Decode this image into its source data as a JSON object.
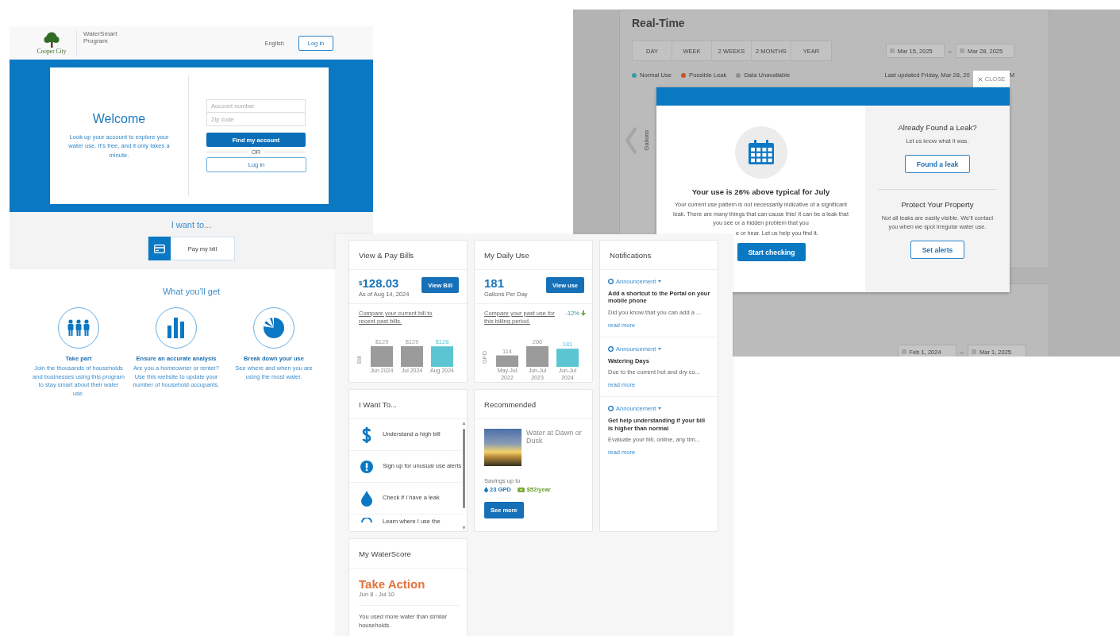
{
  "landing": {
    "logo_text": "Cooper City",
    "program_name": "WaterSmart Program",
    "language": "English",
    "login_button": "Log in",
    "welcome": {
      "title": "Welcome",
      "text": "Look up your account to explore your water use. It’s free, and it only takes a minute.",
      "account_field": {
        "placeholder": "Account number"
      },
      "zip_field": {
        "placeholder": "Zip code"
      },
      "find_button": "Find my account",
      "separator": "OR",
      "login_button": "Log in"
    },
    "i_want_to": {
      "title": "I want to...",
      "action": "Pay my bill"
    },
    "benefits": {
      "title": "What you’ll get",
      "items": [
        {
          "kind": "people",
          "title": "Take part",
          "text": "Join the thousands of households and businesses using this program to stay smart about their water use."
        },
        {
          "kind": "bars",
          "title": "Ensure an accurate analysis",
          "text": "Are you a homeowner or renter? Use this website to update your number of household occupants."
        },
        {
          "kind": "pie",
          "title": "Break down your use",
          "text": "See where and when you are using the most water."
        }
      ]
    }
  },
  "realtime": {
    "title": "Real-Time",
    "ranges": [
      {
        "label": "DAY",
        "selected": false
      },
      {
        "label": "WEEK",
        "selected": false
      },
      {
        "label": "2 WEEKS",
        "selected": false
      },
      {
        "label": "2 MONTHS",
        "selected": false
      },
      {
        "label": "YEAR",
        "selected": false
      }
    ],
    "date_from": "Mar 15, 2025",
    "date_to": "Mar 28, 2025",
    "separator": "–",
    "legend": [
      {
        "label": "Normal Use",
        "color": "#3a9ea6"
      },
      {
        "label": "Possible Leak",
        "color": "#c9542a"
      },
      {
        "label": "Data Unavailable",
        "color": "#8f8f8f"
      }
    ],
    "last_updated": "Last updated Friday, Mar 28, 20",
    "last_updated_end": "M",
    "y_axis_label": "Gallons",
    "modal": {
      "close": "CLOSE",
      "headline": "Your use is 26% above typical for July",
      "body": "Your current use pattern is not necessarily indicative of a significant leak. There are many things that can cause this! It can be a leak that you see or a hidden problem that you",
      "body_cut": "e or hear. Let us help you find it.",
      "primary_button": "Start checking",
      "sections": [
        {
          "title": "Already Found a Leak?",
          "text": "Let us know what it was.",
          "button": "Found a leak"
        },
        {
          "title": "Protect Your Property",
          "text": "Not all leaks are easily visible. We'll contact you when we spot irregular water use.",
          "button": "Set alerts"
        }
      ]
    },
    "lower_range": {
      "date_from": "Feb 1, 2024",
      "date_to": "Mar 1, 2025",
      "separator": "–"
    }
  },
  "dashboard": {
    "bills": {
      "title": "View & Pay Bills",
      "currency": "$",
      "amount": "128.03",
      "as_of": "As of Aug 14, 2024",
      "button": "View Bill",
      "compare_link": "Compare your current bill to recent past bills.",
      "chart_data": {
        "type": "bar",
        "ylabel": "Bill",
        "categories": [
          "Jun 2024",
          "Jul 2024",
          "Aug 2024"
        ],
        "values": [
          129,
          129,
          128
        ],
        "colors": [
          "#9b9b9b",
          "#9b9b9b",
          "#5cc5d2"
        ],
        "value_labels": [
          "$129",
          "$129",
          "$128"
        ]
      }
    },
    "daily_use": {
      "title": "My Daily Use",
      "value": "181",
      "unit": "Gallons Per Day",
      "button": "View use",
      "compare_link": "Compare your past use for this billing period.",
      "change": "-12%",
      "chart_data": {
        "type": "bar",
        "ylabel": "GPD",
        "categories": [
          "May-Jul 2022",
          "Jun-Jul 2023",
          "Jun-Jul 2024"
        ],
        "values": [
          114,
          206,
          181
        ],
        "colors": [
          "#9b9b9b",
          "#9b9b9b",
          "#5cc5d2"
        ],
        "value_labels": [
          "114",
          "206",
          "181"
        ]
      }
    },
    "notifications": {
      "title": "Notifications",
      "items": [
        {
          "type": "Announcement",
          "title": "Add a shortcut to the Portal on your mobile phone",
          "excerpt": "Did you know that you can add a ...",
          "link": "read more"
        },
        {
          "type": "Announcement",
          "title": "Watering Days",
          "excerpt": "Due to the current hot and dry co...",
          "link": "read more"
        },
        {
          "type": "Announcement",
          "title": "Get help understanding if your bill is higher than normal",
          "excerpt": "Evaluate your bill, online, any tim...",
          "link": "read more"
        }
      ]
    },
    "i_want_to": {
      "title": "I Want To...",
      "items": [
        {
          "kind": "dollar",
          "label": "Understand a high bill"
        },
        {
          "kind": "alert",
          "label": "Sign up for unusual use alerts"
        },
        {
          "kind": "drop",
          "label": "Check if I have a leak"
        },
        {
          "kind": "circle",
          "label": "Learn where I use the"
        }
      ]
    },
    "recommended": {
      "title": "Recommended",
      "tip": "Water at Dawn or Dusk",
      "savings_label": "Savings up to",
      "water_savings": "23 GPD",
      "money_savings": "$52/year",
      "button": "See more"
    },
    "waterscore": {
      "title": "My WaterScore",
      "status": "Take Action",
      "period": "Jun 8 - Jul 10",
      "text": "You used more water than similar households."
    }
  }
}
